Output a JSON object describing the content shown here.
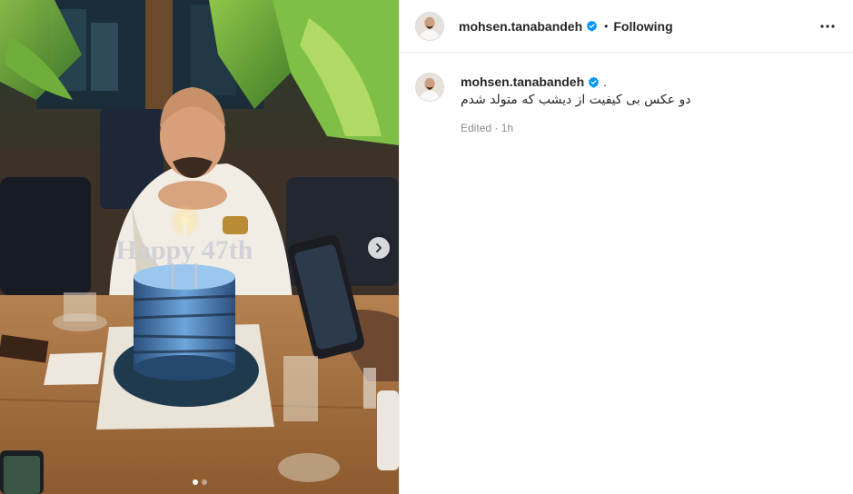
{
  "post": {
    "author": "mohsen.tanabandeh",
    "follow_state": "Following",
    "separator": "•",
    "caption_author": "mohsen.tanabandeh",
    "caption_punct": ".",
    "caption_text": "دو عکس بی کیفیت از دیشب که متولد شدم",
    "meta": "Edited · 1h",
    "cake_text": "Happy 47th"
  },
  "icons": {
    "verified": "verified-badge-icon",
    "more": "more-options-icon",
    "next": "chevron-right-icon"
  },
  "colors": {
    "verified_blue": "#0095f6",
    "meta_gray": "#8e8e8e",
    "cake_blue": "#5f9ed6"
  },
  "carousel": {
    "count": 2,
    "active_index": 0
  }
}
